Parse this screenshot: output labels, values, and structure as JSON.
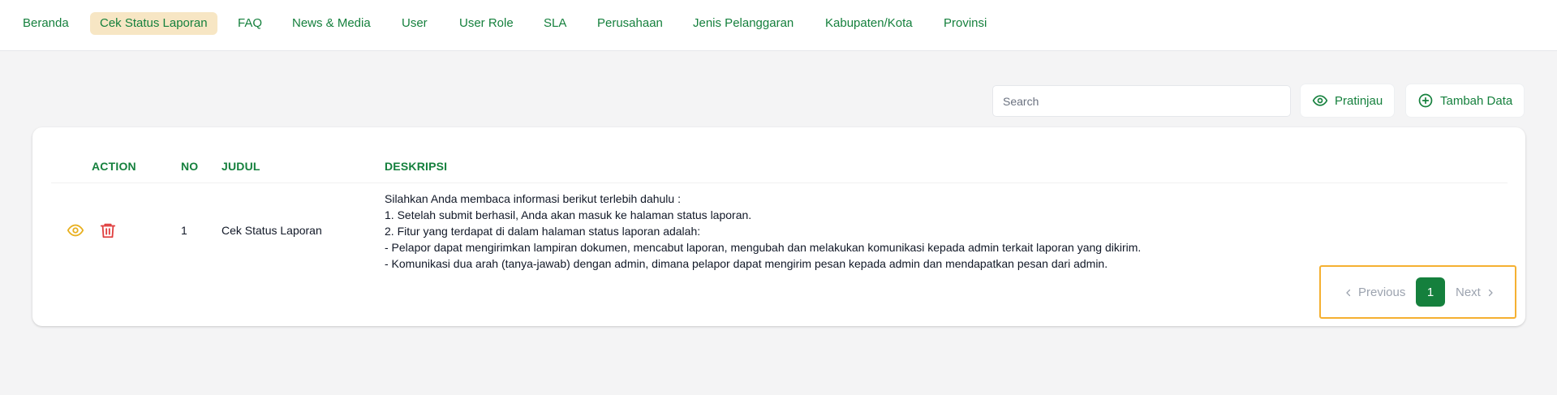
{
  "nav": {
    "items": [
      {
        "label": "Beranda"
      },
      {
        "label": "Cek Status Laporan"
      },
      {
        "label": "FAQ"
      },
      {
        "label": "News & Media"
      },
      {
        "label": "User"
      },
      {
        "label": "User Role"
      },
      {
        "label": "SLA"
      },
      {
        "label": "Perusahaan"
      },
      {
        "label": "Jenis Pelanggaran"
      },
      {
        "label": "Kabupaten/Kota"
      },
      {
        "label": "Provinsi"
      }
    ],
    "active": "Cek Status Laporan"
  },
  "toolbar": {
    "search_placeholder": "Search",
    "search_value": "",
    "preview_label": "Pratinjau",
    "add_label": "Tambah Data"
  },
  "table": {
    "headers": {
      "action": "ACTION",
      "no": "NO",
      "judul": "JUDUL",
      "deskripsi": "DESKRIPSI"
    },
    "rows": [
      {
        "no": "1",
        "judul": "Cek Status Laporan",
        "deskripsi": [
          "Silahkan Anda membaca informasi berikut terlebih dahulu :",
          "1. Setelah submit berhasil, Anda akan masuk ke halaman status laporan.",
          "2. Fitur yang terdapat di dalam halaman status laporan adalah:",
          "- Pelapor dapat mengirimkan lampiran dokumen, mencabut laporan, mengubah dan melakukan komunikasi kepada admin terkait laporan yang dikirim.",
          "- Komunikasi dua arah (tanya-jawab) dengan admin, dimana pelapor dapat mengirim pesan kepada admin dan mendapatkan pesan dari admin."
        ]
      }
    ]
  },
  "pagination": {
    "previous_label": "Previous",
    "current_page": "1",
    "next_label": "Next"
  },
  "colors": {
    "brand_green": "#15803d",
    "active_nav_bg": "#f7e6c4",
    "view_icon": "#e8b020",
    "delete_icon": "#e04040",
    "highlight_border": "#f5b031"
  }
}
